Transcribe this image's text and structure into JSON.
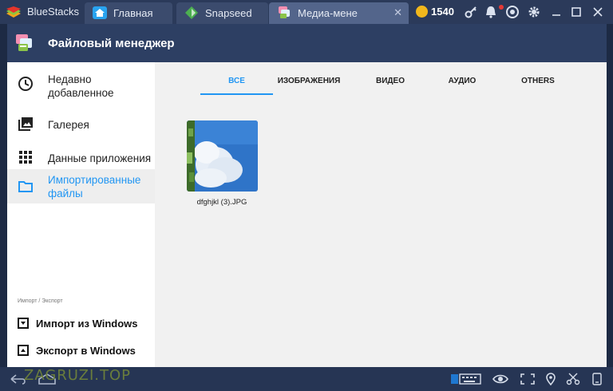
{
  "window": {
    "brand": "BlueStacks",
    "tabs": [
      {
        "label": "Главная",
        "icon": "home-icon"
      },
      {
        "label": "Snapseed",
        "icon": "snapseed-icon"
      },
      {
        "label": "Медиа-мене",
        "icon": "media-manager-icon"
      }
    ],
    "coins": "1540",
    "toolbar_icons": [
      "key-icon",
      "bell-icon",
      "account-icon",
      "gear-icon",
      "minimize-icon",
      "maximize-icon",
      "close-icon"
    ]
  },
  "app": {
    "title": "Файловый менеджер",
    "nav": [
      {
        "label": "Недавно добавленное",
        "icon": "clock-icon"
      },
      {
        "label": "Галерея",
        "icon": "gallery-icon"
      },
      {
        "label": "Данные приложения",
        "icon": "apps-grid-icon"
      },
      {
        "label": "Импортированные файлы",
        "icon": "folder-icon",
        "active": true
      }
    ],
    "section_label": "Импорт / Экспорт",
    "actions": [
      {
        "label": "Импорт из Windows",
        "icon": "import-icon"
      },
      {
        "label": "Экспорт в Windows",
        "icon": "export-icon"
      }
    ],
    "content_tabs": [
      "ВСЕ",
      "ИЗОБРАЖЕНИЯ",
      "ВИДЕО",
      "АУДИО",
      "OTHERS"
    ],
    "active_tab": "ВСЕ",
    "files": [
      {
        "name": "dfghjkl (3).JPG"
      }
    ]
  },
  "bottom_bar": {
    "watermark": "ZAGRUZI.TOP",
    "icons": [
      "back-icon",
      "home-button-icon",
      "keyboard-icon",
      "eye-icon",
      "fullscreen-icon",
      "location-icon",
      "scissors-icon",
      "phone-icon"
    ]
  },
  "colors": {
    "titlebar": "#2b3a5a",
    "appbar": "#2d3f63",
    "accent": "#2196f3"
  }
}
